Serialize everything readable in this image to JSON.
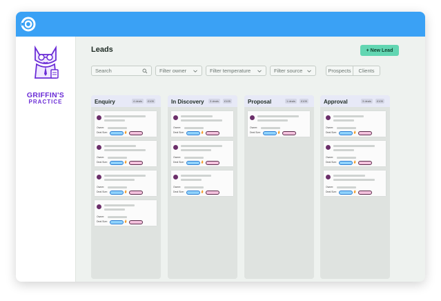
{
  "app": {
    "logo_icon": "app-logo-icon",
    "brand_line1": "GRIFFIN'S",
    "brand_line2": "PRACTICE",
    "mascot_icon": "cat-accountant-mascot"
  },
  "colors": {
    "topbar": "#3aa1f5",
    "accent": "#62d6b2",
    "brand": "#6a2bd6",
    "column_bg": "#dfe3e0",
    "column_header": "#e7e9f7"
  },
  "page": {
    "title": "Leads",
    "new_lead_label": "+ New Lead"
  },
  "toolbar": {
    "search_placeholder": "Search",
    "filter_owner": "Filter owner",
    "filter_temperature": "Filter temperature",
    "filter_source": "Filter source",
    "toggle_prospects": "Prospects",
    "toggle_clients": "Clients"
  },
  "card_labels": {
    "owner": "Owner:",
    "deal_size": "Deal Size:"
  },
  "columns": [
    {
      "title": "Enquiry",
      "count": "4 deals",
      "value": "£105",
      "cards": 4
    },
    {
      "title": "In Discovery",
      "count": "3 deals",
      "value": "£105",
      "cards": 3
    },
    {
      "title": "Proposal",
      "count": "1 deals",
      "value": "£105",
      "cards": 1
    },
    {
      "title": "Approval",
      "count": "3 deals",
      "value": "£105",
      "cards": 3
    }
  ]
}
